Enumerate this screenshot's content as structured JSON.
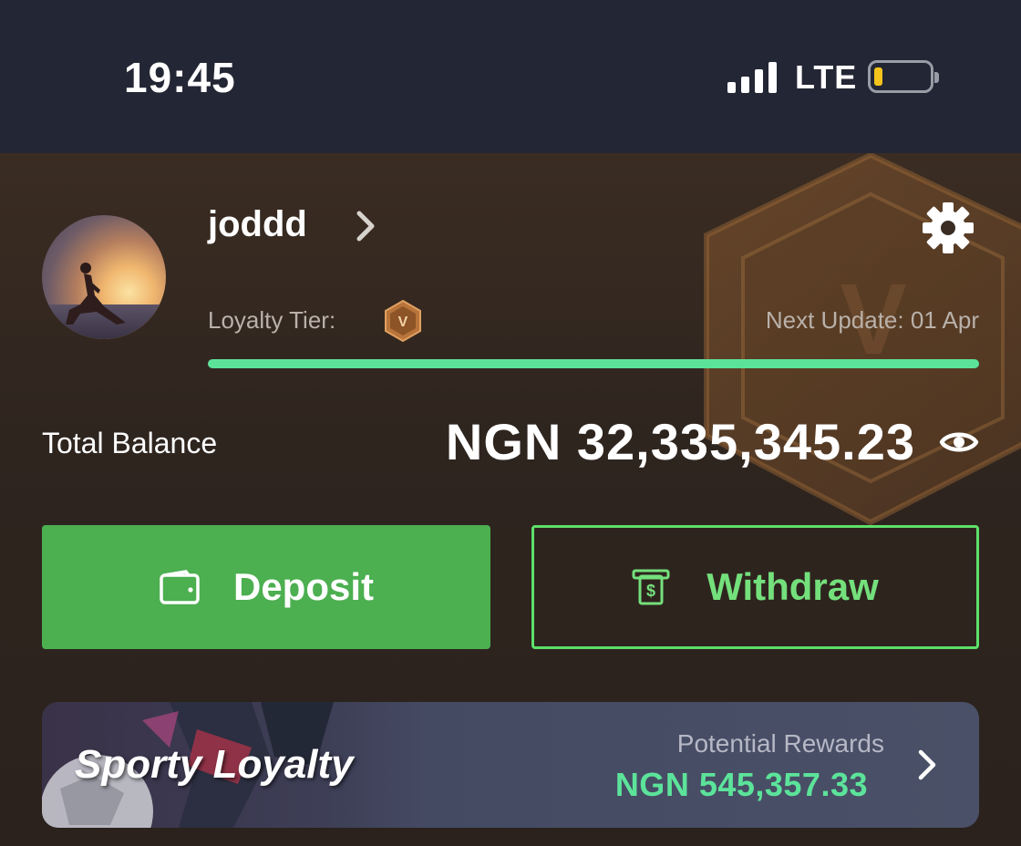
{
  "status_bar": {
    "time": "19:45",
    "network": "LTE",
    "battery_level": 0.12,
    "signal_bars": 4
  },
  "profile": {
    "username": "joddd",
    "loyalty_tier_label": "Loyalty Tier:",
    "tier_badge_letter": "V",
    "next_update": "Next Update: 01 Apr",
    "tier_progress": 1.0
  },
  "balance": {
    "label": "Total Balance",
    "value": "NGN 32,335,345.23"
  },
  "actions": {
    "deposit_label": "Deposit",
    "withdraw_label": "Withdraw"
  },
  "loyalty_card": {
    "title": "Sporty Loyalty",
    "rewards_label": "Potential Rewards",
    "rewards_value": "NGN 545,357.33"
  },
  "colors": {
    "accent_green": "#5ce39a",
    "button_green": "#4caf50",
    "tier_bronze": "#b8743a",
    "battery_yellow": "#f4c41d"
  },
  "icons": [
    "signal-icon",
    "battery-icon",
    "chevron-right-icon",
    "gear-icon",
    "tier-badge-icon",
    "eye-icon",
    "wallet-icon",
    "cash-withdraw-icon"
  ]
}
